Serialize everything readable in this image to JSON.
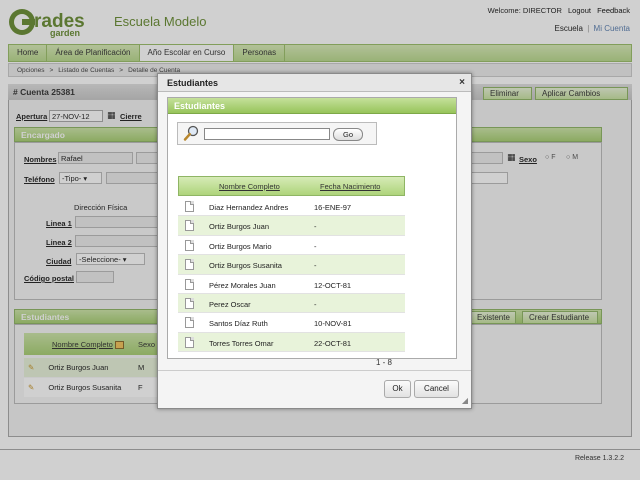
{
  "header": {
    "logo_text": "Grades garden",
    "school_name": "Escuela Modelo",
    "welcome": "Welcome: DIRECTOR",
    "logout": "Logout",
    "feedback": "Feedback",
    "school_link": "Escuela",
    "my_account": "Mi Cuenta"
  },
  "nav": {
    "tabs": [
      {
        "label": "Home"
      },
      {
        "label": "Área de Planificación"
      },
      {
        "label": "Año Escolar en Curso"
      },
      {
        "label": "Personas"
      }
    ]
  },
  "breadcrumb": [
    "Opciones",
    "Listado de Cuentas",
    "Detalle de Cuenta"
  ],
  "account": {
    "title": "# Cuenta 25381",
    "delete_label": "Eliminar",
    "apply_label": "Aplicar Cambios",
    "opening_label": "Apertura",
    "opening_value": "27-NOV-12",
    "closing_label": "Cierre"
  },
  "guardian": {
    "section_title": "Encargado",
    "names_label": "Nombres",
    "names_value": "Rafael",
    "phone_label": "Teléfono",
    "phone_type": "-Tipo-",
    "address_title": "Dirección Física",
    "line1_label": "Linea 1",
    "line2_label": "Linea 2",
    "city_label": "Ciudad",
    "city_value": "-Seleccione-",
    "zip_label": "Código postal",
    "sex_label": "Sexo",
    "sex_f": "F",
    "sex_m": "M"
  },
  "students_section": {
    "title": "Estudiantes",
    "existing_label": "Existente",
    "create_label": "Crear Estudiante",
    "col_name": "Nombre Completo",
    "col_sex": "Sexo",
    "rows": [
      {
        "name": "Ortiz Burgos Juan",
        "sex": "M"
      },
      {
        "name": "Ortiz Burgos Susanita",
        "sex": "F"
      }
    ]
  },
  "footer": {
    "release": "Release 1.3.2.2"
  },
  "modal": {
    "title": "Estudiantes",
    "close": "×",
    "panel_title": "Estudiantes",
    "search_value": "",
    "go_label": "Go",
    "col_name": "Nombre Completo",
    "col_birth": "Fecha Nacimiento",
    "rows": [
      {
        "name": "Diaz Hernandez Andres",
        "birth": "16-ENE-97"
      },
      {
        "name": "Ortiz Burgos Juan",
        "birth": "-"
      },
      {
        "name": "Ortiz Burgos Mario",
        "birth": "-"
      },
      {
        "name": "Ortiz Burgos Susanita",
        "birth": "-"
      },
      {
        "name": "Pérez Morales Juan",
        "birth": "12-OCT-81"
      },
      {
        "name": "Perez Oscar",
        "birth": "-"
      },
      {
        "name": "Santos Díaz Ruth",
        "birth": "10-NOV-81"
      },
      {
        "name": "Torres Torres Omar",
        "birth": "22-OCT-81"
      }
    ],
    "pager": "1 - 8",
    "ok_label": "Ok",
    "cancel_label": "Cancel"
  },
  "colors": {
    "accent_green": "#a8cf73",
    "brand_green": "#6a8e34"
  }
}
